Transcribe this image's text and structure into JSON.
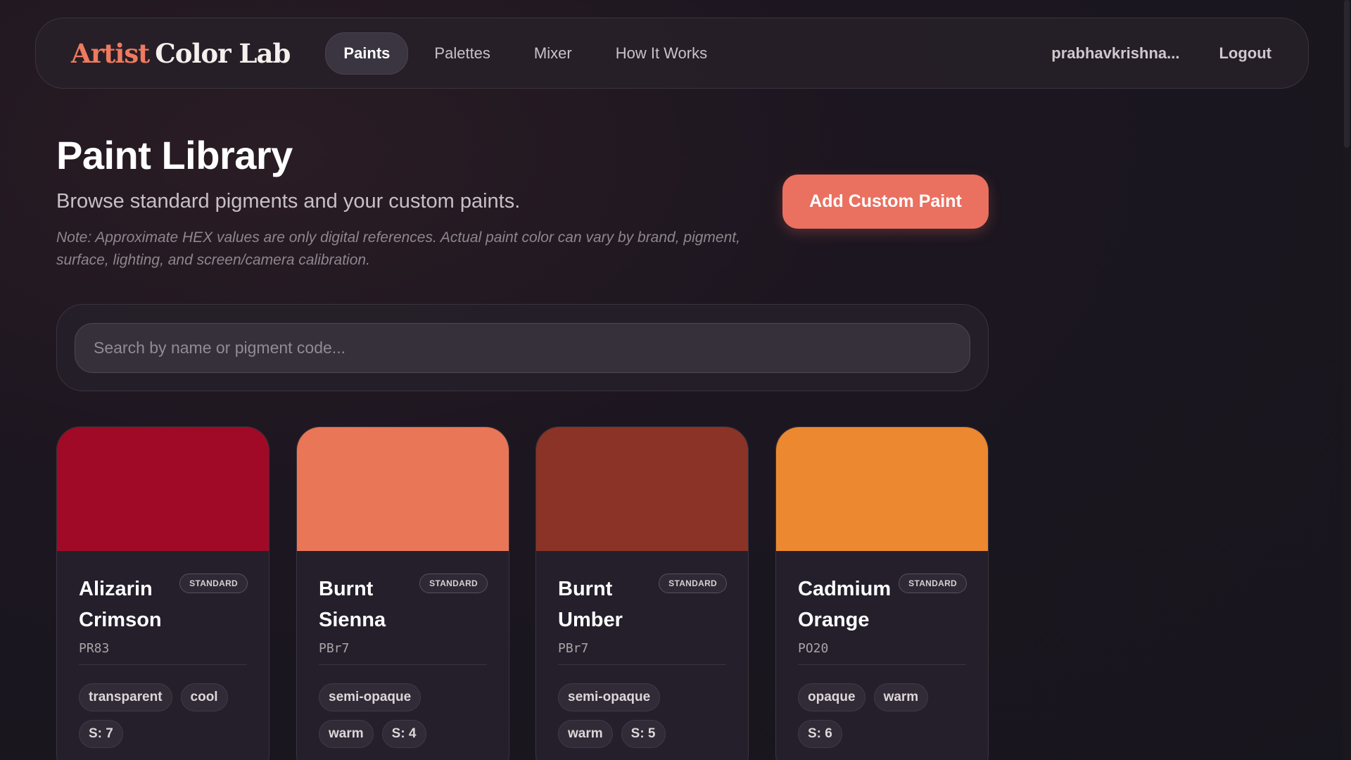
{
  "nav": {
    "brand_part1": "Artist",
    "brand_part2": "Color Lab",
    "items": [
      {
        "label": "Paints",
        "active": true
      },
      {
        "label": "Palettes",
        "active": false
      },
      {
        "label": "Mixer",
        "active": false
      },
      {
        "label": "How It Works",
        "active": false
      }
    ],
    "user": "prabhavkrishna...",
    "logout": "Logout"
  },
  "header": {
    "title": "Paint Library",
    "subtitle": "Browse standard pigments and your custom paints.",
    "note": "Note: Approximate HEX values are only digital references. Actual paint color can vary by brand, pigment, surface, lighting, and screen/camera calibration.",
    "add_button": "Add Custom Paint"
  },
  "search": {
    "placeholder": "Search by name or pigment code...",
    "value": ""
  },
  "paints": [
    {
      "name": "Alizarin Crimson",
      "code": "PR83",
      "badge": "STANDARD",
      "color": "#a00a26",
      "tags": [
        "transparent",
        "cool",
        "S: 7"
      ]
    },
    {
      "name": "Burnt Sienna",
      "code": "PBr7",
      "badge": "STANDARD",
      "color": "#e97656",
      "tags": [
        "semi-opaque",
        "warm",
        "S: 4"
      ]
    },
    {
      "name": "Burnt Umber",
      "code": "PBr7",
      "badge": "STANDARD",
      "color": "#8b3327",
      "tags": [
        "semi-opaque",
        "warm",
        "S: 5"
      ]
    },
    {
      "name": "Cadmium Orange",
      "code": "PO20",
      "badge": "STANDARD",
      "color": "#ec882f",
      "tags": [
        "opaque",
        "warm",
        "S: 6"
      ]
    }
  ],
  "colors": {
    "accent": "#ea7060",
    "background": "#1c1620"
  }
}
